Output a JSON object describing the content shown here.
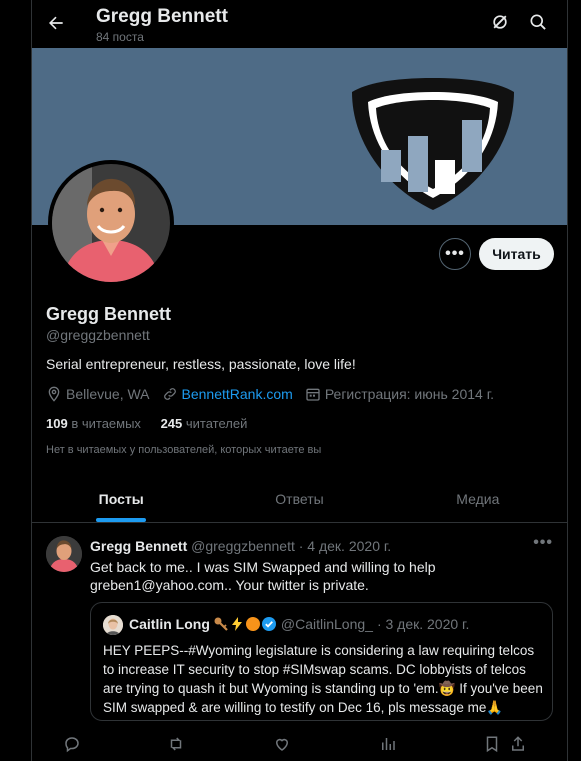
{
  "header": {
    "title": "Gregg Bennett",
    "post_count": "84 поста"
  },
  "profile": {
    "name": "Gregg Bennett",
    "handle": "@greggzbennett",
    "bio": "Serial entrepreneur, restless, passionate, love life!",
    "location": "Bellevue, WA",
    "website": "BennettRank.com",
    "joined": "Регистрация: июнь 2014 г.",
    "following_count": "109",
    "following_label": "в читаемых",
    "followers_count": "245",
    "followers_label": "читателей",
    "mutual_note": "Нет в читаемых у пользователей, которых читаете вы",
    "follow_button": "Читать",
    "more_button": "•••"
  },
  "tabs": [
    {
      "label": "Посты",
      "active": true
    },
    {
      "label": "Ответы",
      "active": false
    },
    {
      "label": "Медиа",
      "active": false
    }
  ],
  "tweet": {
    "author": "Gregg Bennett",
    "handle": "@greggzbennett",
    "date": "· 4 дек. 2020 г.",
    "text": "Get back to me.. I was SIM Swapped and willing to help greben1@yahoo.com.. Your twitter is private.",
    "quote": {
      "author": "Caitlin Long",
      "handle": "@CaitlinLong_",
      "date": "· 3 дек. 2020 г.",
      "text": "HEY PEEPS--#Wyoming legislature is considering a law requiring telcos to increase IT security to stop #SIMswap scams. DC lobbyists of telcos are trying to quash it but Wyoming is standing up to 'em.🤠 If you've been SIM swapped & are willing to testify on Dec 16, pls message me🙏"
    }
  },
  "colors": {
    "accent": "#1d9bf0",
    "banner": "#4e6b86",
    "background": "#000000",
    "muted": "#71767b"
  }
}
